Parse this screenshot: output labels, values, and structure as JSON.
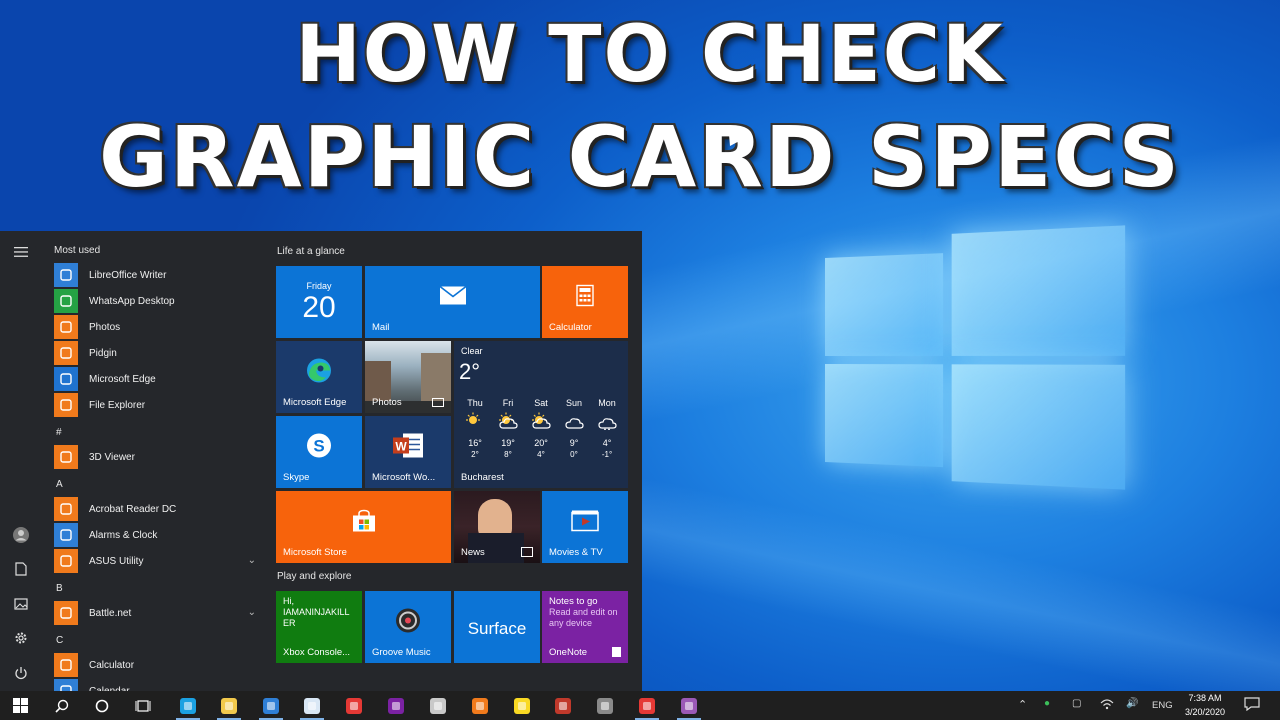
{
  "title": {
    "line1": "HOW TO CHECK",
    "line2": "GRAPHIC CARD SPECS"
  },
  "start_menu": {
    "most_used_label": "Most used",
    "apps": [
      {
        "label": "LibreOffice Writer",
        "icon": "document-icon",
        "color": "#2f7fd6"
      },
      {
        "label": "WhatsApp Desktop",
        "icon": "whatsapp-icon",
        "color": "#25a244"
      },
      {
        "label": "Photos",
        "icon": "photos-icon",
        "color": "#f07a1c"
      },
      {
        "label": "Pidgin",
        "icon": "pidgin-icon",
        "color": "#f07a1c"
      },
      {
        "label": "Microsoft Edge",
        "icon": "edge-icon",
        "color": "#1f73d0"
      },
      {
        "label": "File Explorer",
        "icon": "folder-icon",
        "color": "#f07a1c"
      },
      {
        "label": "3D Viewer",
        "icon": "cube-icon",
        "color": "#f07a1c"
      },
      {
        "label": "Acrobat Reader DC",
        "icon": "pdf-icon",
        "color": "#f07a1c"
      },
      {
        "label": "Alarms & Clock",
        "icon": "clock-icon",
        "color": "#2f7fd6"
      },
      {
        "label": "ASUS Utility",
        "icon": "folder-icon",
        "color": "#f07a1c"
      },
      {
        "label": "Battle.net",
        "icon": "folder-icon",
        "color": "#f07a1c"
      },
      {
        "label": "Calculator",
        "icon": "calculator-icon",
        "color": "#f07a1c"
      },
      {
        "label": "Calendar",
        "icon": "calendar-icon",
        "color": "#2f7fd6"
      }
    ],
    "sections": [
      "#",
      "A",
      "B",
      "C"
    ],
    "group1_label": "Life at a glance",
    "group2_label": "Play and explore",
    "tiles": {
      "calendar_day": "Friday",
      "calendar_date": "20",
      "mail": "Mail",
      "calculator": "Calculator",
      "edge": "Microsoft Edge",
      "photos": "Photos",
      "skype": "Skype",
      "word": "Microsoft Wo...",
      "store": "Microsoft Store",
      "news": "News",
      "movies": "Movies & TV",
      "xbox_text": "Hi,\nIAMANINJAKILL\nER",
      "xbox": "Xbox Console...",
      "groove": "Groove Music",
      "surface": "Surface",
      "onenote_title": "Notes to go",
      "onenote_sub": "Read and edit on any device",
      "onenote": "OneNote"
    },
    "weather": {
      "condition": "Clear",
      "temp": "2°",
      "city": "Bucharest",
      "days": [
        {
          "day": "Thu",
          "hi": "16°",
          "lo": "2°",
          "icon": "sun-icon"
        },
        {
          "day": "Fri",
          "hi": "19°",
          "lo": "8°",
          "icon": "sun-cloud-icon"
        },
        {
          "day": "Sat",
          "hi": "20°",
          "lo": "4°",
          "icon": "sun-cloud-icon"
        },
        {
          "day": "Sun",
          "hi": "9°",
          "lo": "0°",
          "icon": "cloud-icon"
        },
        {
          "day": "Mon",
          "hi": "4°",
          "lo": "-1°",
          "icon": "snow-cloud-icon"
        }
      ]
    }
  },
  "taskbar": {
    "language": "ENG",
    "time": "7:38 AM",
    "date": "3/20/2020"
  },
  "colors": {
    "tile_blue": "#0c74d6",
    "tile_dark": "#1b3a6b",
    "tile_orange": "#f7630c",
    "tile_green": "#107c10",
    "tile_purple": "#7b22a3"
  }
}
